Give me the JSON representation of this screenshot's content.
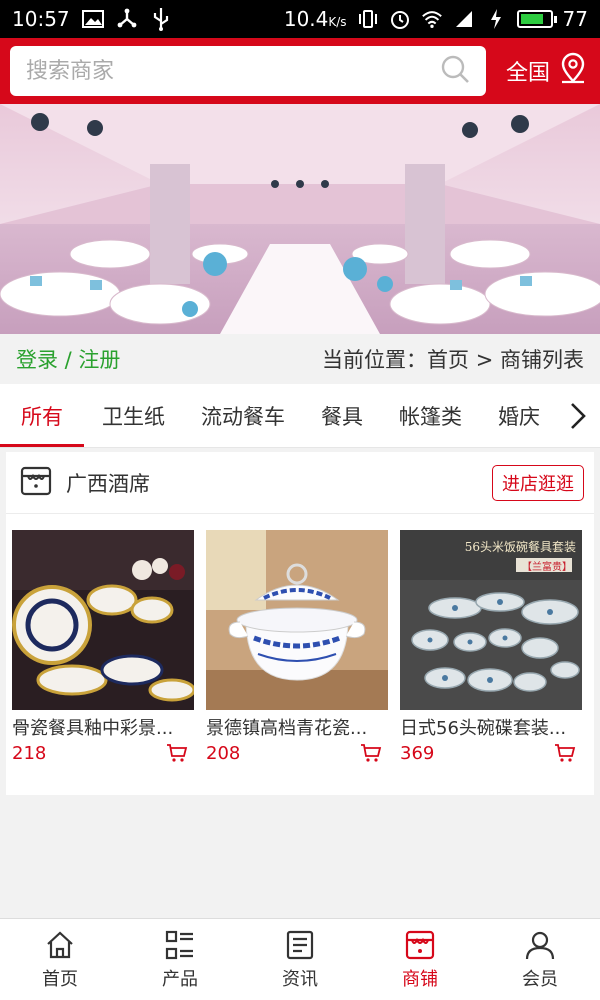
{
  "status_bar": {
    "time": "10:57",
    "net_speed": "10.4",
    "net_unit": "K/s",
    "battery": "77",
    "battery_level": 0.77
  },
  "search": {
    "placeholder": "搜索商家"
  },
  "region": {
    "label": "全国"
  },
  "location_bar": {
    "login_label": "登录 / 注册",
    "breadcrumb": "当前位置：首页 > 商铺列表"
  },
  "categories": [
    "所有",
    "卫生纸",
    "流动餐车",
    "餐具",
    "帐篷类",
    "婚庆"
  ],
  "active_category": 0,
  "shop": {
    "name": "广西酒席",
    "visit_label": "进店逛逛",
    "products": [
      {
        "title": "骨瓷餐具釉中彩景...",
        "price": "218"
      },
      {
        "title": "景德镇高档青花瓷...",
        "price": "208"
      },
      {
        "title": "日式56头碗碟套装...",
        "price": "369"
      }
    ],
    "product3_overlay": {
      "title": "56头米饭碗餐具套装",
      "tag": "【兰富贵】"
    }
  },
  "bottom_nav": [
    {
      "label": "首页",
      "icon": "home-icon"
    },
    {
      "label": "产品",
      "icon": "products-icon"
    },
    {
      "label": "资讯",
      "icon": "news-icon"
    },
    {
      "label": "商铺",
      "icon": "shop-icon"
    },
    {
      "label": "会员",
      "icon": "member-icon"
    }
  ],
  "active_nav": 3,
  "colors": {
    "brand_red": "#d6081a",
    "login_green": "#2aa12e",
    "background": "#f2f2f2"
  }
}
